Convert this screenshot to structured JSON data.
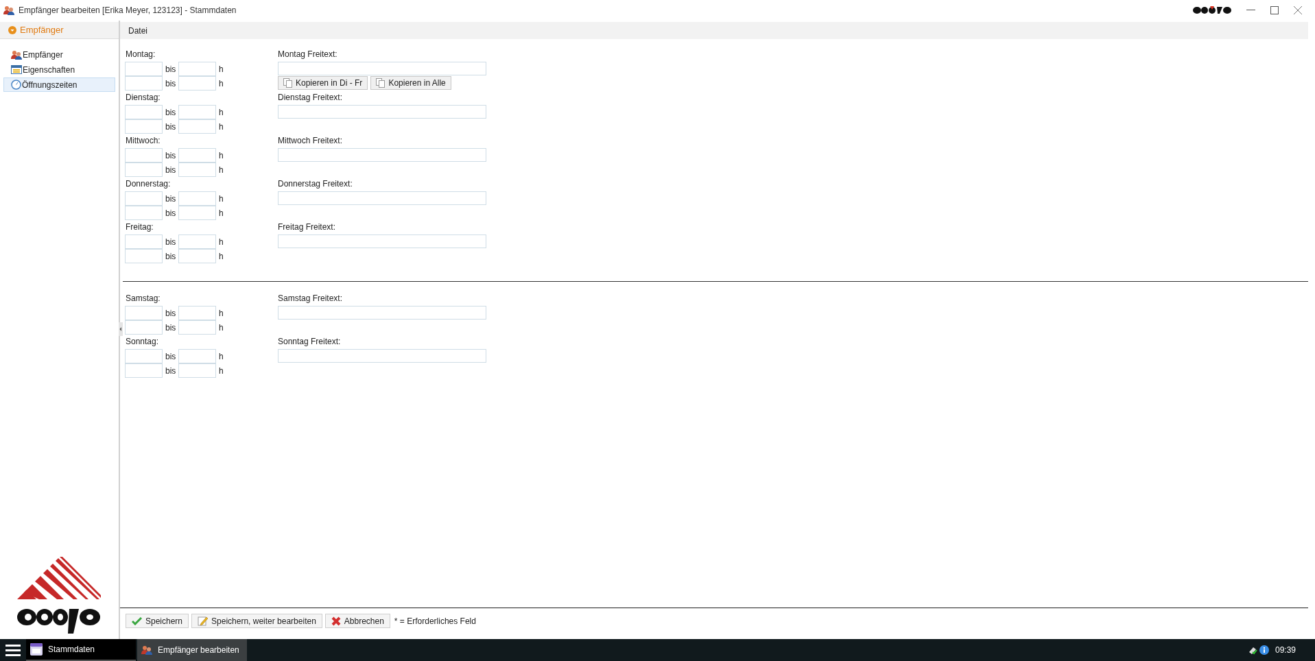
{
  "window": {
    "title": "Empfänger bearbeiten [Erika Meyer, 123123] - Stammdaten"
  },
  "sidebar": {
    "header": "Empfänger",
    "items": [
      {
        "label": "Empfänger",
        "kind": "people",
        "selected": false
      },
      {
        "label": "Eigenschaften",
        "kind": "list",
        "selected": false
      },
      {
        "label": "Öffnungszeiten",
        "kind": "clock",
        "selected": true
      }
    ]
  },
  "menu": [
    "Datei"
  ],
  "day_groups": [
    [
      {
        "label": "Montag:",
        "freetext_label": "Montag Freitext:",
        "ranges": [
          {
            "separator": "bis",
            "unit": "h"
          },
          {
            "separator": "bis",
            "unit": "h"
          }
        ],
        "copy_buttons": [
          "Kopieren in Di - Fr",
          "Kopieren in Alle"
        ]
      },
      {
        "label": "Dienstag:",
        "freetext_label": "Dienstag Freitext:",
        "ranges": [
          {
            "separator": "bis",
            "unit": "h"
          },
          {
            "separator": "bis",
            "unit": "h"
          }
        ]
      },
      {
        "label": "Mittwoch:",
        "freetext_label": "Mittwoch Freitext:",
        "ranges": [
          {
            "separator": "bis",
            "unit": "h"
          },
          {
            "separator": "bis",
            "unit": "h"
          }
        ]
      },
      {
        "label": "Donnerstag:",
        "freetext_label": "Donnerstag Freitext:",
        "ranges": [
          {
            "separator": "bis",
            "unit": "h"
          },
          {
            "separator": "bis",
            "unit": "h"
          }
        ]
      },
      {
        "label": "Freitag:",
        "freetext_label": "Freitag Freitext:",
        "ranges": [
          {
            "separator": "bis",
            "unit": "h"
          },
          {
            "separator": "bis",
            "unit": "h"
          }
        ]
      }
    ],
    [
      {
        "label": "Samstag:",
        "freetext_label": "Samstag Freitext:",
        "ranges": [
          {
            "separator": "bis",
            "unit": "h"
          },
          {
            "separator": "bis",
            "unit": "h"
          }
        ]
      },
      {
        "label": "Sonntag:",
        "freetext_label": "Sonntag Freitext:",
        "ranges": [
          {
            "separator": "bis",
            "unit": "h"
          },
          {
            "separator": "bis",
            "unit": "h"
          }
        ]
      }
    ]
  ],
  "footer": {
    "buttons": [
      {
        "label": "Speichern",
        "kind": "save"
      },
      {
        "label": "Speichern, weiter bearbeiten",
        "kind": "edit"
      },
      {
        "label": "Abbrechen",
        "kind": "cancel"
      }
    ],
    "note": "* = Erforderliches Feld"
  },
  "taskbar": {
    "items": [
      {
        "label": "Stammdaten",
        "kind": "calendar",
        "selected": false
      },
      {
        "label": "Empfänger bearbeiten",
        "kind": "people",
        "selected": true
      }
    ],
    "clock": "09:39"
  }
}
